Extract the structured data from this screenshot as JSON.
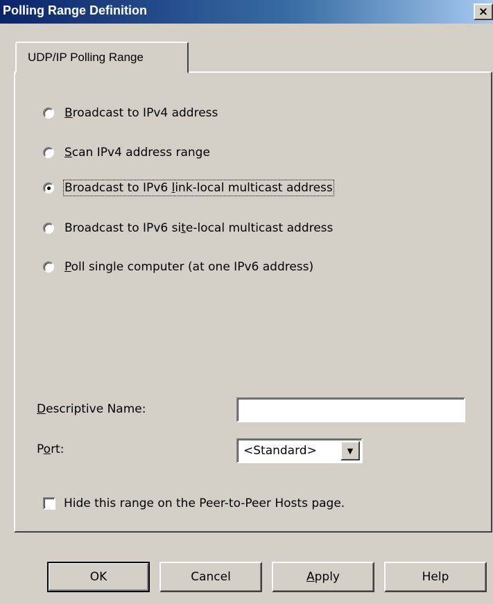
{
  "window": {
    "title": "Polling Range Definition",
    "close_glyph": "×"
  },
  "tabs": [
    {
      "label": "UDP/IP Polling Range",
      "selected": true
    }
  ],
  "polling_options": {
    "selected_index": 2,
    "items": [
      {
        "mnemonic": "B",
        "rest": "roadcast to IPv4 address"
      },
      {
        "mnemonic": "S",
        "rest": "can IPv4 address range"
      },
      {
        "pre": "Broadcast to IPv6 ",
        "mnemonic": "l",
        "rest": "ink-local multicast address"
      },
      {
        "pre": "Broadcast to IPv6 si",
        "mnemonic": "t",
        "rest": "e-local multicast address"
      },
      {
        "mnemonic": "P",
        "rest": "oll single computer (at one IPv6 address)"
      }
    ]
  },
  "descriptive_name": {
    "label_mnemonic": "D",
    "label_rest": "escriptive Name:",
    "value": ""
  },
  "port": {
    "label_pre": "P",
    "label_mnemonic": "o",
    "label_rest": "rt:",
    "selected": "<Standard>"
  },
  "hide_range": {
    "label": "Hide this range on the Peer-to-Peer Hosts page.",
    "checked": false
  },
  "buttons": {
    "ok": "OK",
    "cancel": "Cancel",
    "apply_mnemonic": "A",
    "apply_rest": "pply",
    "help": "Help"
  },
  "icons": {
    "close": "close-icon",
    "dropdown": "chevron-down-icon",
    "arrow_glyph": "▼"
  }
}
